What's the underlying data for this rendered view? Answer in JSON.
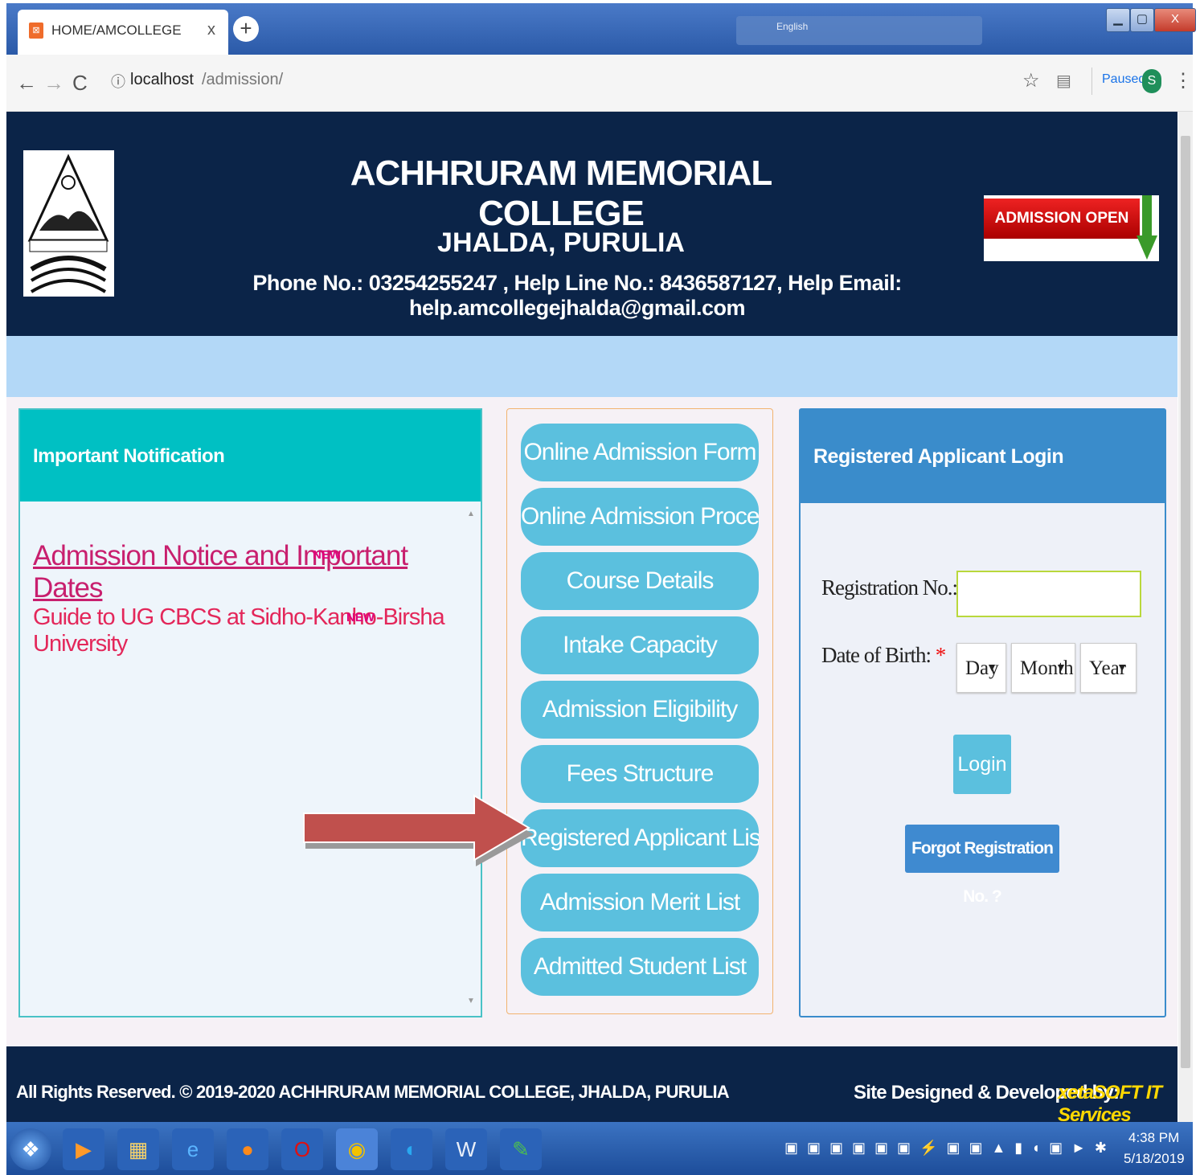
{
  "browser": {
    "tab_title": "HOME/AMCOLLEGE",
    "tab_close": "x",
    "url_host": "localhost",
    "url_path": "/admission/",
    "paused_label": "Paused",
    "avatar_letter": "S",
    "lang_label": "English"
  },
  "header": {
    "title": "ACHHRURAM MEMORIAL COLLEGE",
    "subtitle": "JHALDA, PURULIA",
    "contact": "Phone No.: 03254255247 , Help Line No.: 8436587127, Help Email: help.amcollegejhalda@gmail.com",
    "admission_badge": "ADMISSION OPEN"
  },
  "notifications": {
    "title": "Important Notification",
    "items": [
      {
        "text": "Admission Notice and Important Dates",
        "badge": "NEW"
      },
      {
        "text": "Guide to UG CBCS at Sidho-Kanho-Birsha University",
        "badge": "NEW"
      }
    ]
  },
  "menu": {
    "items": [
      "Online Admission Form",
      "Online Admission Procedure",
      "Course Details",
      "Intake Capacity",
      "Admission Eligibility",
      "Fees Structure",
      "Registered Applicant List",
      "Admission Merit List",
      "Admitted Student List"
    ]
  },
  "login": {
    "title": "Registered Applicant Login",
    "reg_label": "Registration No.:",
    "dob_label": "Date of Birth:",
    "required_mark": "*",
    "reg_value": "",
    "day": "Day",
    "month": "Month",
    "year": "Year",
    "login_button": "Login",
    "forgot_button": "Forgot Registration No. ?"
  },
  "footer": {
    "rights": "All Rights Reserved. © 2019-2020 ACHHRURAM MEMORIAL COLLEGE, JHALDA, PURULIA",
    "designed_by": "Site Designed & Developed by:",
    "developer": "xetaSOFT IT Services"
  },
  "taskbar": {
    "time": "4:38 PM",
    "date": "5/18/2019"
  },
  "colors": {
    "header_bg": "#0b2448",
    "menu_button": "#5bc0de",
    "notif_header": "#00c0c3",
    "login_header": "#3a8ccb",
    "arrow": "#c0504d"
  }
}
